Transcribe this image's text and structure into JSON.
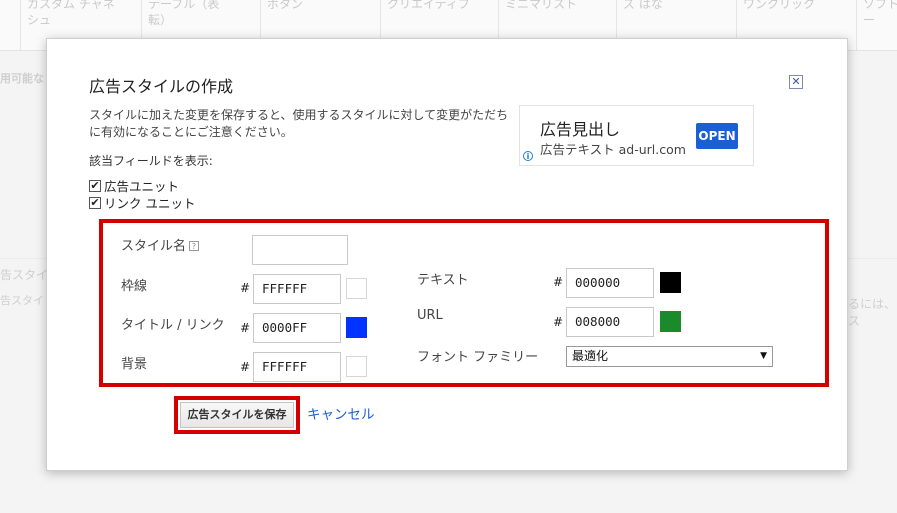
{
  "background": {
    "columns": [
      {
        "text": "カスタム チャネ\nシュ"
      },
      {
        "text": "テーブル（表\n転）"
      },
      {
        "text": "ボタン"
      },
      {
        "text": "クリエイティブ"
      },
      {
        "text": "ミニマリスト"
      },
      {
        "text": "ズ はな"
      },
      {
        "text": "ワンクリック"
      },
      {
        "text": "ソフトフ\nー"
      }
    ],
    "side_labels": [
      "用可能な",
      "告スタイ",
      "告スタイ"
    ],
    "right_fragment": "るには、ス"
  },
  "dialog": {
    "title": "広告スタイルの作成",
    "close_glyph": "✕",
    "description": "スタイルに加えた変更を保存すると、使用するスタイルに対して変更がただちに有効になることにご注意ください。",
    "show_fields_label": "該当フィールドを表示:",
    "checkboxes": [
      {
        "label": "広告ユニット",
        "checked": "✔"
      },
      {
        "label": "リンク ユニット",
        "checked": "✔"
      }
    ]
  },
  "ad_preview": {
    "headline": "広告見出し",
    "subtext": "広告テキスト ad-url.com",
    "button": "OPEN",
    "info_glyph": "i"
  },
  "form": {
    "style_name_label": "スタイル名",
    "help_glyph": "?",
    "style_name_value": "",
    "hash": "#",
    "border": {
      "label": "枠線",
      "value": "FFFFFF",
      "color": "#FFFFFF"
    },
    "title_link": {
      "label": "タイトル / リンク",
      "value": "0000FF",
      "color": "#0033FF"
    },
    "background": {
      "label": "背景",
      "value": "FFFFFF",
      "color": "#FFFFFF"
    },
    "text": {
      "label": "テキスト",
      "value": "000000",
      "color": "#000000"
    },
    "url": {
      "label": "URL",
      "value": "008000",
      "color": "#1A8A2A"
    },
    "font_family": {
      "label": "フォント ファミリー",
      "value": "最適化",
      "arrow": "▼"
    }
  },
  "actions": {
    "save": "広告スタイルを保存",
    "cancel": "キャンセル"
  },
  "colors": {
    "highlight": "#d40000",
    "link": "#1a5fd4"
  }
}
